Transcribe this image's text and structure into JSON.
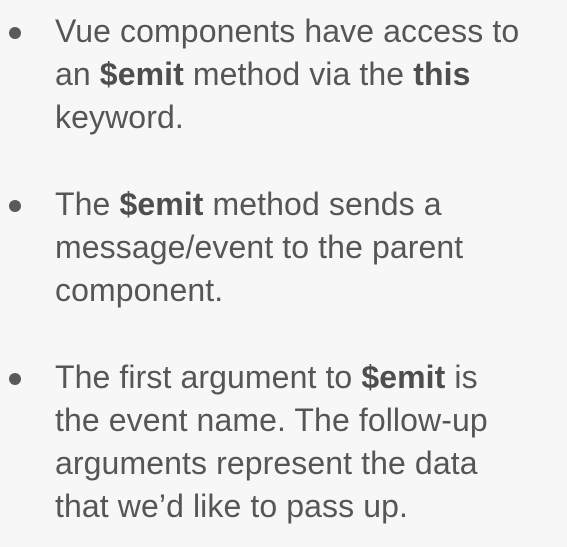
{
  "bullets": [
    {
      "lines": [
        [
          {
            "text": "Vue components have access to",
            "bold": false
          }
        ],
        [
          {
            "text": "an ",
            "bold": false
          },
          {
            "text": "$emit",
            "bold": true
          },
          {
            "text": " method via the ",
            "bold": false
          },
          {
            "text": "this",
            "bold": true
          }
        ],
        [
          {
            "text": "keyword.",
            "bold": false
          }
        ]
      ]
    },
    {
      "lines": [
        [
          {
            "text": "The ",
            "bold": false
          },
          {
            "text": "$emit",
            "bold": true
          },
          {
            "text": " method sends a",
            "bold": false
          }
        ],
        [
          {
            "text": "message/event to the parent",
            "bold": false
          }
        ],
        [
          {
            "text": "component.",
            "bold": false
          }
        ]
      ]
    },
    {
      "lines": [
        [
          {
            "text": "The first argument to ",
            "bold": false
          },
          {
            "text": "$emit",
            "bold": true
          },
          {
            "text": " is",
            "bold": false
          }
        ],
        [
          {
            "text": "the event name. The follow-up",
            "bold": false
          }
        ],
        [
          {
            "text": "arguments represent the data",
            "bold": false
          }
        ],
        [
          {
            "text": "that we’d like to pass up.",
            "bold": false
          }
        ]
      ]
    }
  ]
}
